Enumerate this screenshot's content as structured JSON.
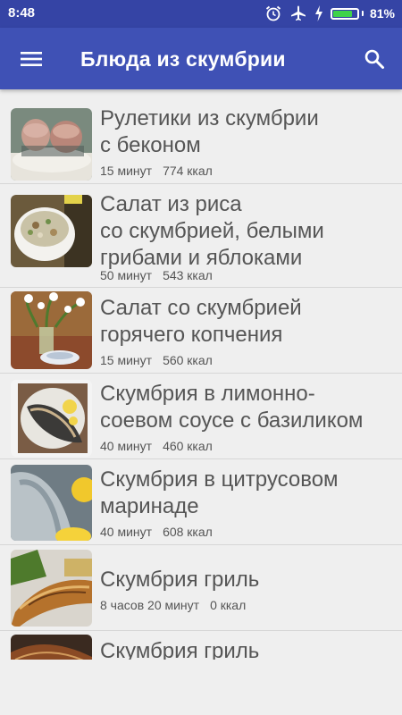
{
  "status_bar": {
    "time": "8:48",
    "icons": [
      "alarm-icon",
      "airplane-icon",
      "charging-icon"
    ],
    "battery_percent": 81,
    "battery_label": "81%"
  },
  "app_bar": {
    "title": "Блюда из скумбрии",
    "menu_icon": "hamburger-menu-icon",
    "search_icon": "search-icon"
  },
  "colors": {
    "status_bar": "#3544a5",
    "app_bar": "#3f51b5",
    "background": "#efefef",
    "text": "#555555",
    "battery_fill": "#3fd24a"
  },
  "recipes": [
    {
      "title_lines": [
        "Рулетики из скумбрии",
        "с беконом"
      ],
      "time": "15 минут",
      "kcal": "774 ккал"
    },
    {
      "title_lines": [
        "Салат из риса",
        "со скумбрией, белыми",
        "грибами и яблоками"
      ],
      "time": "50 минут",
      "kcal": "543 ккал"
    },
    {
      "title_lines": [
        "Салат со скумбрией",
        "горячего копчения"
      ],
      "time": "15 минут",
      "kcal": "560 ккал"
    },
    {
      "title_lines": [
        "Скумбрия в лимонно-",
        "соевом соусе с базиликом"
      ],
      "time": "40 минут",
      "kcal": "460 ккал"
    },
    {
      "title_lines": [
        "Скумбрия в цитрусовом",
        "маринаде"
      ],
      "time": "40 минут",
      "kcal": "608 ккал"
    },
    {
      "title_lines": [
        "Скумбрия гриль"
      ],
      "time": "8 часов 20 минут",
      "kcal": "0 ккал"
    },
    {
      "title_lines": [
        "Скумбрия гриль"
      ],
      "time": "",
      "kcal": ""
    }
  ]
}
